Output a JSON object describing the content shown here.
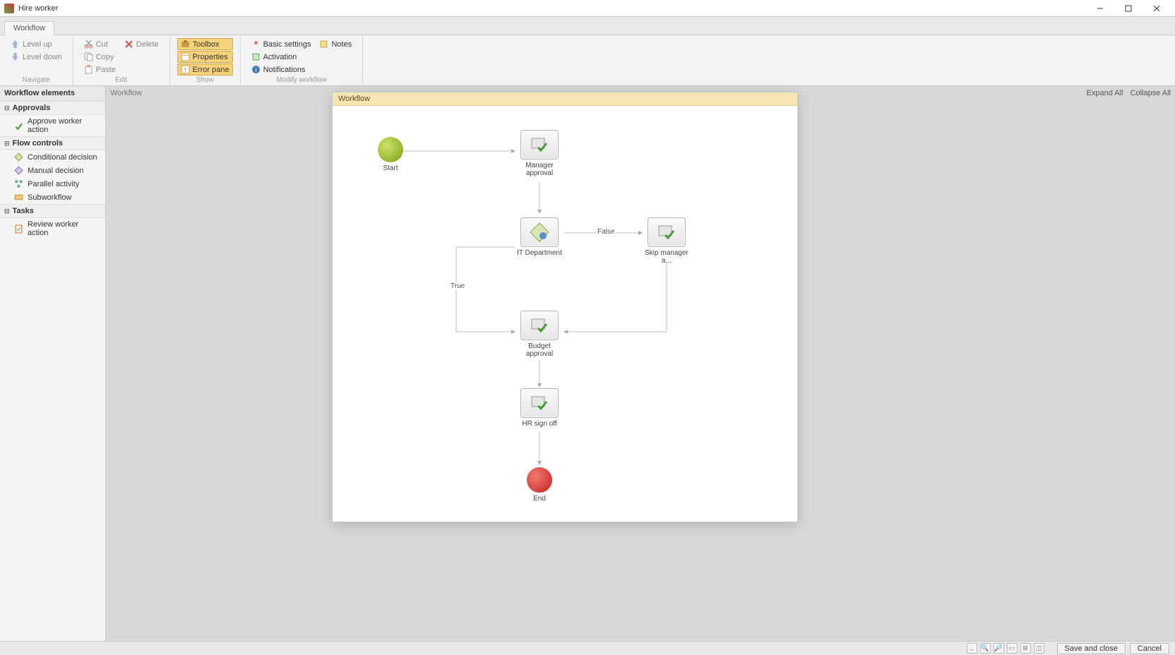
{
  "window": {
    "title": "Hire worker"
  },
  "tabs": {
    "workflow": "Workflow"
  },
  "ribbon": {
    "navigate": {
      "label": "Navigate",
      "level_up": "Level up",
      "level_down": "Level down"
    },
    "edit": {
      "label": "Edit",
      "cut": "Cut",
      "copy": "Copy",
      "paste": "Paste",
      "delete": "Delete"
    },
    "show": {
      "label": "Show",
      "toolbox": "Toolbox",
      "properties": "Properties",
      "error_pane": "Error pane"
    },
    "modify": {
      "label": "Modify workflow",
      "basic_settings": "Basic settings",
      "activation": "Activation",
      "notifications": "Notifications",
      "notes": "Notes"
    }
  },
  "left_panel": {
    "title": "Workflow elements",
    "approvals": {
      "label": "Approvals",
      "approve_worker": "Approve worker action"
    },
    "flow_controls": {
      "label": "Flow controls",
      "conditional_decision": "Conditional decision",
      "manual_decision": "Manual decision",
      "parallel_activity": "Parallel activity",
      "subworkflow": "Subworkflow"
    },
    "tasks": {
      "label": "Tasks",
      "review_worker": "Review worker action"
    }
  },
  "canvas": {
    "breadcrumb": "Workflow",
    "expand_all": "Expand All",
    "collapse_all": "Collapse All",
    "title": "Workflow",
    "nodes": {
      "start": "Start",
      "manager_approval": "Manager approval",
      "it_department": "IT Department",
      "skip_manager": "Skip manager a...",
      "budget_approval": "Budget approval",
      "hr_sign_off": "HR sign off",
      "end": "End"
    },
    "edges": {
      "true": "True",
      "false": "False"
    }
  },
  "footer": {
    "save_close": "Save and close",
    "cancel": "Cancel"
  }
}
